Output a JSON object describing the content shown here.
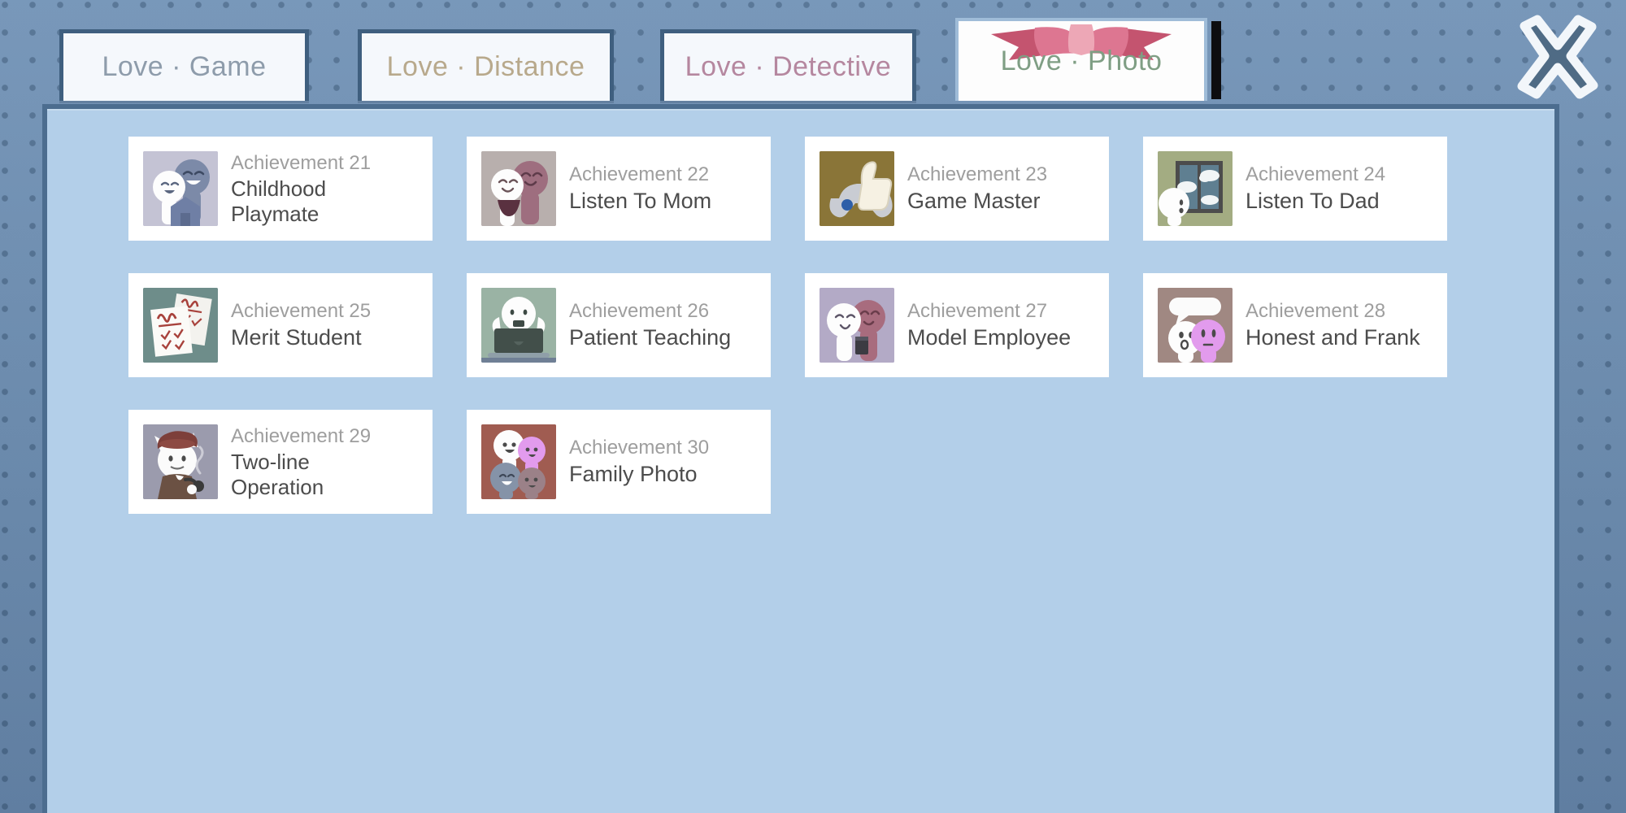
{
  "window": {
    "close_icon": "close-x-icon",
    "active_tab_decoration": "pink-ribbon-bow"
  },
  "tabs": [
    {
      "id": "love-game",
      "label": "Love · Game",
      "color": "#8e9cab",
      "active": false
    },
    {
      "id": "love-distance",
      "label": "Love · Distance",
      "color": "#b8a98c",
      "active": false
    },
    {
      "id": "love-detective",
      "label": "Love · Detective",
      "color": "#b5879f",
      "active": false
    },
    {
      "id": "love-photo",
      "label": "Love · Photo",
      "color": "#7f9e84",
      "active": true
    }
  ],
  "achievements": [
    {
      "number": "Achievement 21",
      "name": "Childhood Playmate",
      "lines": 2,
      "icon": "two-kids-and-house-icon",
      "bg": "#c4c3d4"
    },
    {
      "number": "Achievement 22",
      "name": "Listen To Mom",
      "lines": 1,
      "icon": "child-with-bowl-and-mother-icon",
      "bg": "#b8afad"
    },
    {
      "number": "Achievement 23",
      "name": "Game Master",
      "lines": 1,
      "icon": "gamepad-thumbs-up-icon",
      "bg": "#8a7538"
    },
    {
      "number": "Achievement 24",
      "name": "Listen To Dad",
      "lines": 1,
      "icon": "window-with-clouds-icon",
      "bg": "#a3ac82"
    },
    {
      "number": "Achievement 25",
      "name": "Merit Student",
      "lines": 1,
      "icon": "graded-test-papers-icon",
      "bg": "#6e8d8a"
    },
    {
      "number": "Achievement 26",
      "name": "Patient Teaching",
      "lines": 1,
      "icon": "character-with-laptop-icon",
      "bg": "#9ab3a4"
    },
    {
      "number": "Achievement 27",
      "name": "Model Employee",
      "lines": 1,
      "icon": "two-characters-coffee-icon",
      "bg": "#b3aac6"
    },
    {
      "number": "Achievement 28",
      "name": "Honest and Frank",
      "lines": 1,
      "icon": "speech-bubble-two-characters-icon",
      "bg": "#a08882"
    },
    {
      "number": "Achievement 29",
      "name": "Two-line Operation",
      "lines": 2,
      "icon": "detective-cat-with-pipe-icon",
      "bg": "#9b9bad"
    },
    {
      "number": "Achievement 30",
      "name": "Family Photo",
      "lines": 1,
      "icon": "family-of-four-icon",
      "bg": "#a05c51"
    }
  ],
  "colors": {
    "backdrop": "#6e8eb1",
    "panel_body": "#b3cfe9",
    "panel_border": "#4c6d8f",
    "tab_face": "#f5f8fc",
    "tab_border": "#3f5f7f",
    "ribbon_pink": "#d2607f",
    "card_white": "#ffffff",
    "ach_number_gray": "#9e9e9e",
    "ach_name_gray": "#4c4c4c"
  }
}
